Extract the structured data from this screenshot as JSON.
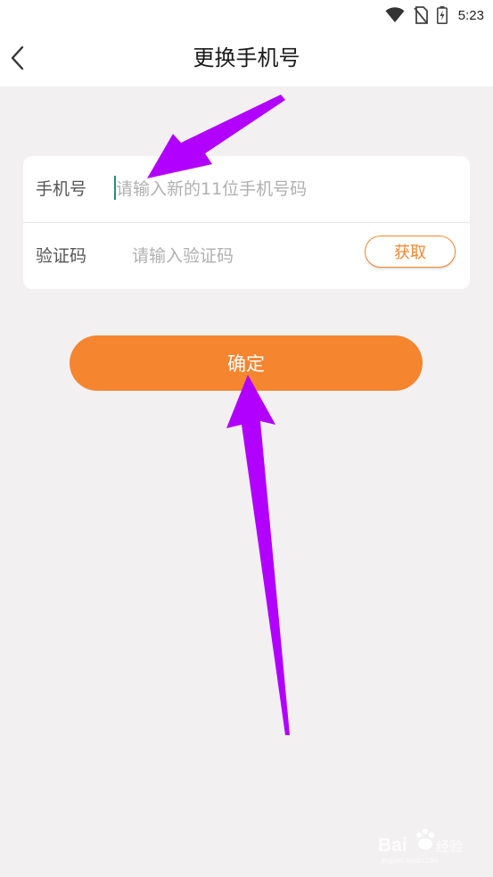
{
  "status_bar": {
    "time": "5:23",
    "icons": [
      "wifi-icon",
      "no-sim-icon",
      "battery-charging-icon"
    ]
  },
  "nav": {
    "back_icon": "chevron-left-icon",
    "title": "更换手机号"
  },
  "form": {
    "phone": {
      "label": "手机号",
      "placeholder": "请输入新的11位手机号码",
      "value": ""
    },
    "code": {
      "label": "验证码",
      "placeholder": "请输入验证码",
      "value": "",
      "get_button_label": "获取"
    }
  },
  "confirm_button_label": "确定",
  "annotations": {
    "arrow_color": "#b200ff"
  },
  "watermark": {
    "brand": "Baidu",
    "sub": "jingyan.baidu.com"
  },
  "colors": {
    "accent": "#f5852f",
    "background": "#f2f0f1",
    "caret": "#1f8f84"
  }
}
